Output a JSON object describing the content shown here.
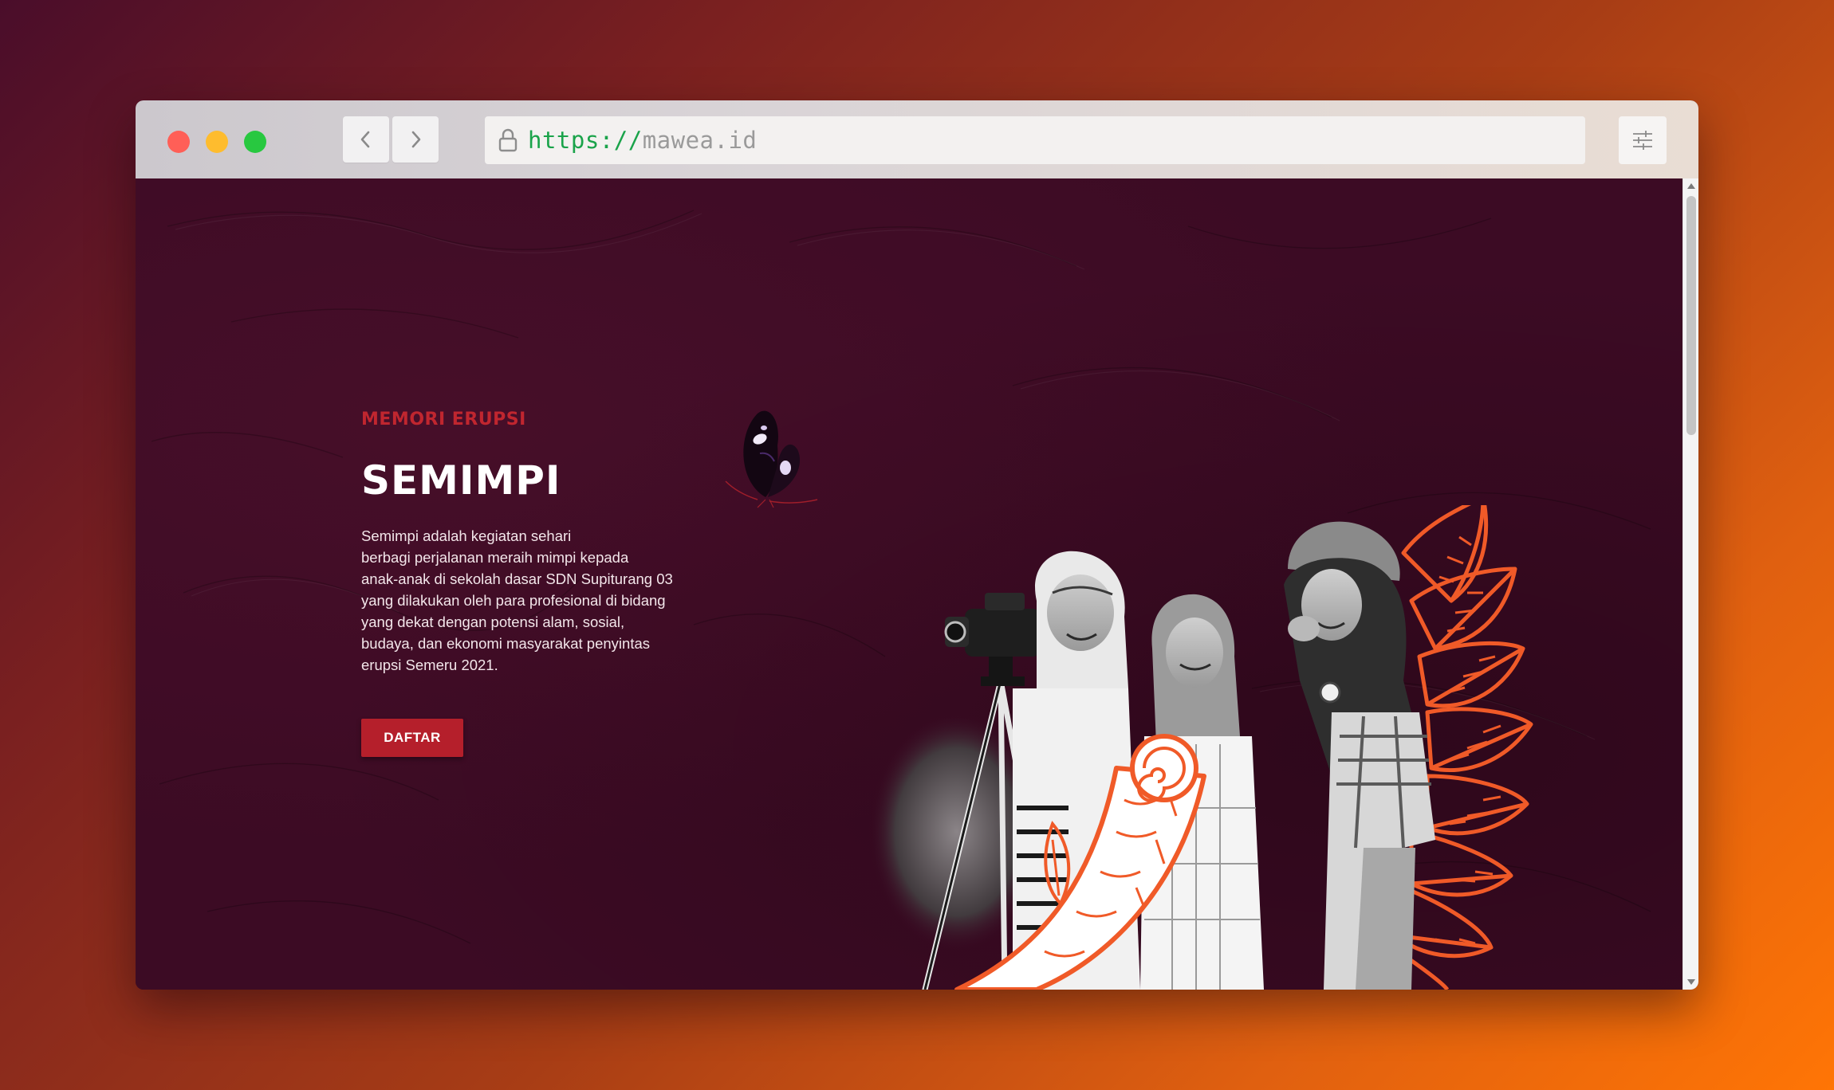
{
  "browser": {
    "url_scheme": "https://",
    "url_host": "mawea.id"
  },
  "hero": {
    "eyebrow": "MEMORI ERUPSI",
    "title": "SEMIMPI",
    "description_lines": [
      "Semimpi adalah kegiatan sehari",
      "berbagi perjalanan meraih mimpi kepada",
      "anak-anak di sekolah dasar SDN Supiturang 03",
      "yang dilakukan oleh para profesional di bidang",
      "yang dekat dengan potensi alam, sosial,",
      "budaya, dan ekonomi masyarakat penyintas",
      "erupsi Semeru 2021."
    ],
    "cta_label": "DAFTAR"
  },
  "icons": {
    "back": "chevron-left-icon",
    "forward": "chevron-right-icon",
    "lock": "lock-icon",
    "menu": "sliders-icon"
  },
  "colors": {
    "page_background": "#3c0b24",
    "accent_red": "#c0262f",
    "button_red": "#b51f2b",
    "leaf_orange": "#f05a28",
    "url_scheme_green": "#1aa34a"
  }
}
